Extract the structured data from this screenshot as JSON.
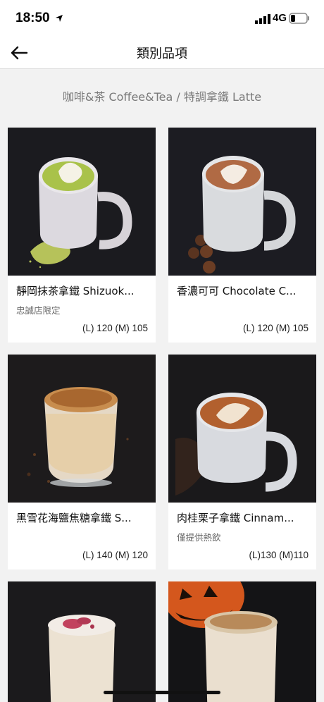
{
  "status_bar": {
    "time": "18:50",
    "network": "4G"
  },
  "header": {
    "title": "類別品項"
  },
  "category": {
    "label": "咖啡&茶 Coffee&Tea / 特調拿鐵 Latte"
  },
  "products": [
    {
      "name": "靜岡抹茶拿鐵 Shizuok...",
      "note": "忠誠店限定",
      "price": "(L) 120 (M) 105"
    },
    {
      "name": "香濃可可 Chocolate C...",
      "note": "",
      "price": "(L) 120 (M) 105"
    },
    {
      "name": "黑雪花海鹽焦糖拿鐵 S...",
      "note": "",
      "price": "(L) 140 (M) 120"
    },
    {
      "name": "肉桂栗子拿鐵 Cinnam...",
      "note": "僅提供熱飲",
      "price": "(L)130 (M)110"
    },
    {
      "name": "",
      "note": "",
      "price": ""
    },
    {
      "name": "",
      "note": "",
      "price": ""
    }
  ],
  "colors": {
    "photo_bg": "#1b1b1f",
    "cup": "#e3e3e6",
    "matcha": "#a9c24a",
    "cocoa": "#b06a44"
  }
}
